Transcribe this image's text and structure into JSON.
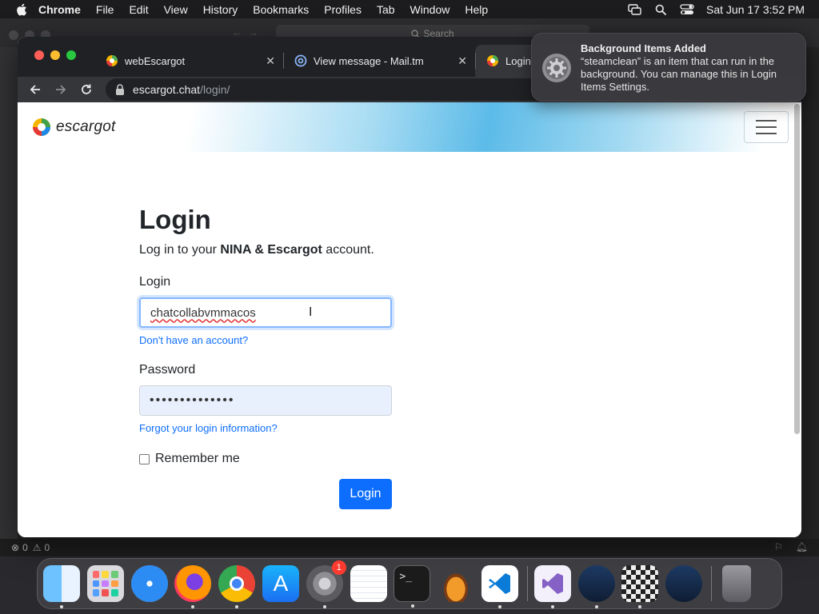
{
  "menubar": {
    "app_name": "Chrome",
    "items": [
      "File",
      "Edit",
      "View",
      "History",
      "Bookmarks",
      "Profiles",
      "Tab",
      "Window",
      "Help"
    ],
    "clock": "Sat Jun 17  3:52 PM"
  },
  "background_window": {
    "search_placeholder": "Search",
    "status_errors": "0",
    "status_warnings": "0"
  },
  "browser": {
    "tabs": [
      {
        "title": "webEscargot",
        "active": false
      },
      {
        "title": "View message - Mail.tm",
        "active": false
      },
      {
        "title": "Login",
        "active": true
      }
    ],
    "url_host": "escargot.chat",
    "url_path": "/login/"
  },
  "page": {
    "brand": "escargot",
    "heading": "Login",
    "subtitle_pre": "Log in to your ",
    "subtitle_bold": "NINA & Escargot",
    "subtitle_post": " account.",
    "login_label": "Login",
    "login_value": "chatcollabvmmacos",
    "signup_link": "Don't have an account?",
    "password_label": "Password",
    "password_value": "••••••••••••••",
    "forgot_link": "Forgot your login information?",
    "remember_label": "Remember me",
    "submit_label": "Login"
  },
  "notification": {
    "title": "Background Items Added",
    "body": "“steamclean” is an item that can run in the background. You can manage this in Login Items Settings."
  },
  "dock": {
    "apps": [
      "Finder",
      "Launchpad",
      "Safari",
      "Firefox",
      "Google Chrome",
      "App Store",
      "System Settings",
      "TextEdit",
      "Terminal",
      "GarageBand",
      "Visual Studio Code",
      "Visual Studio",
      "Steam",
      "Chess",
      "Steam",
      "Trash"
    ],
    "settings_badge": "1"
  },
  "colors": {
    "accent": "#0d6efd",
    "link": "#0d6efd",
    "close_red": "#ff5f57",
    "minimize_yellow": "#febc2e",
    "zoom_green": "#28c840"
  }
}
